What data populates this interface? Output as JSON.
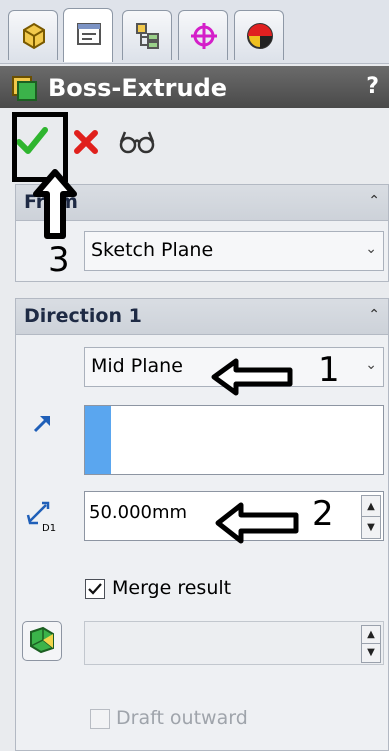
{
  "tabs": [
    {
      "icon": "feature-manager-icon",
      "active": false
    },
    {
      "icon": "property-manager-icon",
      "active": true
    },
    {
      "icon": "configuration-manager-icon",
      "active": false
    },
    {
      "icon": "dimxpert-icon",
      "active": false
    },
    {
      "icon": "display-manager-icon",
      "active": false
    }
  ],
  "title": {
    "text": "Boss-Extrude",
    "help": "?"
  },
  "actions": {
    "ok_icon": "checkmark-icon",
    "cancel_icon": "x-icon",
    "preview_icon": "detailed-preview-icon"
  },
  "from": {
    "title": "From",
    "start_condition": "Sketch Plane"
  },
  "direction1": {
    "title": "Direction 1",
    "end_condition": "Mid Plane",
    "depth": "50.000mm",
    "merge_result": {
      "label": "Merge result",
      "checked": true
    },
    "draft_outward": {
      "label": "Draft outward",
      "checked": false,
      "enabled": false
    }
  },
  "annotations": {
    "one": "1",
    "two": "2",
    "three": "3"
  },
  "colors": {
    "ok": "#2fb52f",
    "cancel": "#e0201c",
    "selection": "#5aa6ef",
    "direction_arrow": "#1f5fb8"
  }
}
